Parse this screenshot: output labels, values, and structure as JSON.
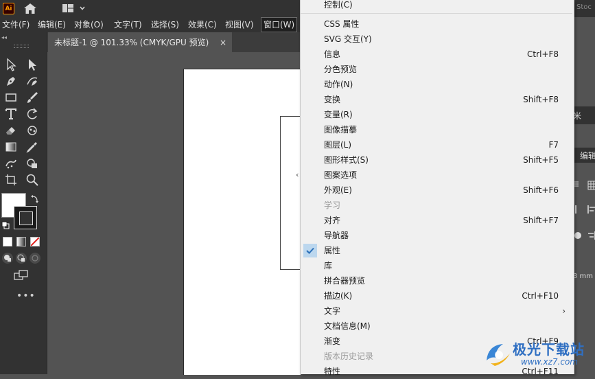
{
  "app": {
    "logo_text": "Ai",
    "stock_label": "Stoc"
  },
  "menubar": {
    "items": [
      {
        "label": "文件(F)"
      },
      {
        "label": "编辑(E)"
      },
      {
        "label": "对象(O)"
      },
      {
        "label": "文字(T)"
      },
      {
        "label": "选择(S)"
      },
      {
        "label": "效果(C)"
      },
      {
        "label": "视图(V)"
      },
      {
        "label": "窗口(W)"
      }
    ]
  },
  "document": {
    "tab_title": "未标题-1 @ 101.33% (CMYK/GPU 预览)",
    "close_glyph": "×"
  },
  "toolbar": {
    "more_label": "•••",
    "collapse_glyph": "◂◂"
  },
  "window_menu": {
    "items": [
      {
        "label": "控制(C)",
        "shortcut": "",
        "disabled": false,
        "checked": false,
        "submenu": false
      },
      {
        "label": "CSS 属性",
        "shortcut": "",
        "disabled": false,
        "checked": false,
        "submenu": false
      },
      {
        "label": "SVG 交互(Y)",
        "shortcut": "",
        "disabled": false,
        "checked": false,
        "submenu": false
      },
      {
        "label": "信息",
        "shortcut": "Ctrl+F8",
        "disabled": false,
        "checked": false,
        "submenu": false
      },
      {
        "label": "分色预览",
        "shortcut": "",
        "disabled": false,
        "checked": false,
        "submenu": false
      },
      {
        "label": "动作(N)",
        "shortcut": "",
        "disabled": false,
        "checked": false,
        "submenu": false
      },
      {
        "label": "变换",
        "shortcut": "Shift+F8",
        "disabled": false,
        "checked": false,
        "submenu": false
      },
      {
        "label": "变量(R)",
        "shortcut": "",
        "disabled": false,
        "checked": false,
        "submenu": false
      },
      {
        "label": "图像描摹",
        "shortcut": "",
        "disabled": false,
        "checked": false,
        "submenu": false
      },
      {
        "label": "图层(L)",
        "shortcut": "F7",
        "disabled": false,
        "checked": false,
        "submenu": false
      },
      {
        "label": "图形样式(S)",
        "shortcut": "Shift+F5",
        "disabled": false,
        "checked": false,
        "submenu": false
      },
      {
        "label": "图案选项",
        "shortcut": "",
        "disabled": false,
        "checked": false,
        "submenu": false
      },
      {
        "label": "外观(E)",
        "shortcut": "Shift+F6",
        "disabled": false,
        "checked": false,
        "submenu": false
      },
      {
        "label": "学习",
        "shortcut": "",
        "disabled": true,
        "checked": false,
        "submenu": false
      },
      {
        "label": "对齐",
        "shortcut": "Shift+F7",
        "disabled": false,
        "checked": false,
        "submenu": false
      },
      {
        "label": "导航器",
        "shortcut": "",
        "disabled": false,
        "checked": false,
        "submenu": false
      },
      {
        "label": "属性",
        "shortcut": "",
        "disabled": false,
        "checked": true,
        "submenu": false
      },
      {
        "label": "库",
        "shortcut": "",
        "disabled": false,
        "checked": false,
        "submenu": false
      },
      {
        "label": "拼合器预览",
        "shortcut": "",
        "disabled": false,
        "checked": false,
        "submenu": false
      },
      {
        "label": "描边(K)",
        "shortcut": "Ctrl+F10",
        "disabled": false,
        "checked": false,
        "submenu": false
      },
      {
        "label": "文字",
        "shortcut": "",
        "disabled": false,
        "checked": false,
        "submenu": true
      },
      {
        "label": "文档信息(M)",
        "shortcut": "",
        "disabled": false,
        "checked": false,
        "submenu": false
      },
      {
        "label": "渐变",
        "shortcut": "Ctrl+F9",
        "disabled": false,
        "checked": false,
        "submenu": false
      },
      {
        "label": "版本历史记录",
        "shortcut": "",
        "disabled": true,
        "checked": false,
        "submenu": false
      },
      {
        "label": "特性",
        "shortcut": "Ctrl+F11",
        "disabled": false,
        "checked": false,
        "submenu": false
      }
    ]
  },
  "right_panel": {
    "tab_fragment": "米",
    "edit_fragment": "编辑",
    "unit_fragment": "3 mm"
  },
  "watermark": {
    "name": "极光下载站",
    "url": "www.xz7.com"
  },
  "colors": {
    "menu_bg": "#f0f0f0",
    "check_bg": "#bcd7ee",
    "check_mark": "#2a6fb8",
    "app_bar": "#323232",
    "canvas": "#535353",
    "accent_logo": "#ff9a00"
  }
}
